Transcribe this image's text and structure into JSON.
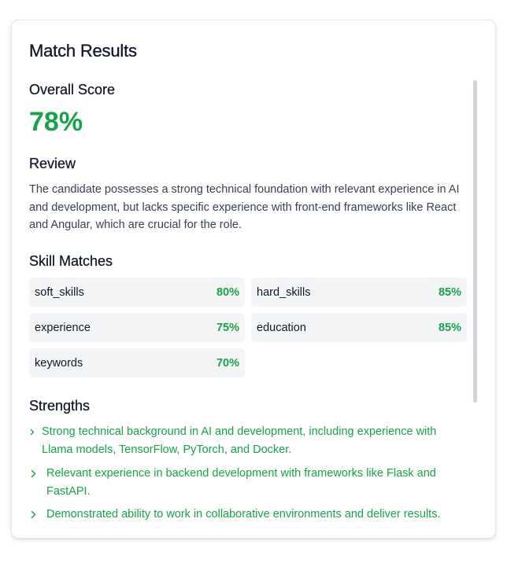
{
  "card": {
    "title": "Match Results"
  },
  "overall": {
    "heading": "Overall Score",
    "score": "78%"
  },
  "review": {
    "heading": "Review",
    "text": "The candidate possesses a strong technical foundation with relevant experience in AI and development, but lacks specific experience with front-end frameworks like React and Angular, which are crucial for the role."
  },
  "skills": {
    "heading": "Skill Matches",
    "items": [
      {
        "name": "soft_skills",
        "pct": "80%"
      },
      {
        "name": "hard_skills",
        "pct": "85%"
      },
      {
        "name": "experience",
        "pct": "75%"
      },
      {
        "name": "education",
        "pct": "85%"
      },
      {
        "name": "keywords",
        "pct": "70%"
      }
    ]
  },
  "strengths": {
    "heading": "Strengths",
    "items": [
      "Strong technical background in AI and development, including experience with Llama models, TensorFlow, PyTorch, and Docker.",
      "Relevant experience in backend development with frameworks like Flask and FastAPI.",
      "Demonstrated ability to work in collaborative environments and deliver results."
    ],
    "bullet_icon": "chevron-right-icon"
  },
  "colors": {
    "accent": "#16a34a",
    "cell_bg": "#f3f4f6",
    "text": "#111827",
    "muted": "#374151"
  }
}
